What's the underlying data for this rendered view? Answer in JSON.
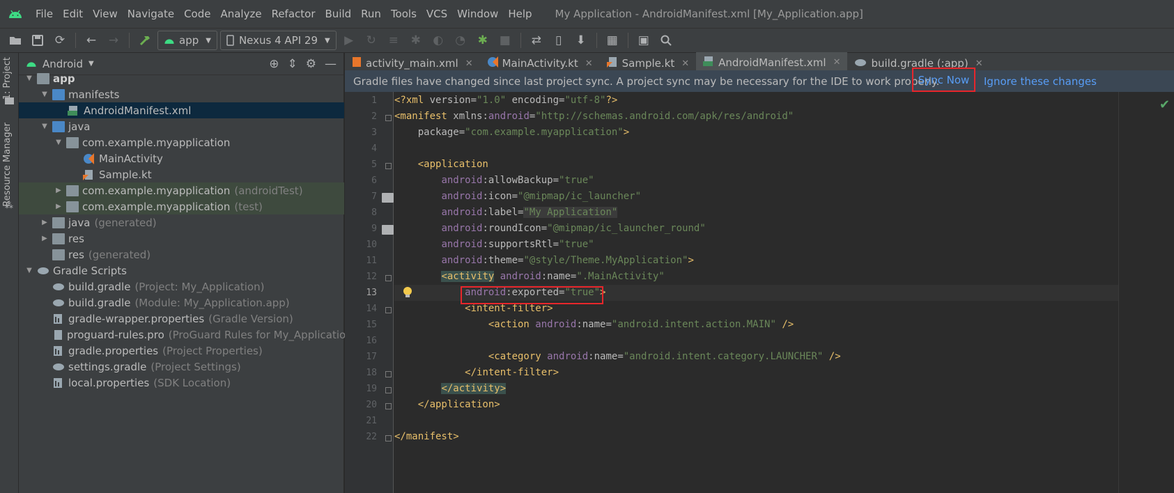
{
  "menubar": {
    "items": [
      "File",
      "Edit",
      "View",
      "Navigate",
      "Code",
      "Analyze",
      "Refactor",
      "Build",
      "Run",
      "Tools",
      "VCS",
      "Window",
      "Help"
    ],
    "title": "My Application - AndroidManifest.xml [My_Application.app]"
  },
  "toolbar": {
    "run_config": "app",
    "device": "Nexus 4 API 29"
  },
  "left_strip": {
    "project_label": "1: Project",
    "resource_manager_label": "Resource Manager"
  },
  "project_panel": {
    "view_mode": "Android",
    "tree": [
      {
        "label": "app",
        "hint": "",
        "bold": true
      },
      {
        "label": "manifests",
        "hint": ""
      },
      {
        "label": "AndroidManifest.xml",
        "hint": ""
      },
      {
        "label": "java",
        "hint": ""
      },
      {
        "label": "com.example.myapplication",
        "hint": ""
      },
      {
        "label": "MainActivity",
        "hint": ""
      },
      {
        "label": "Sample.kt",
        "hint": ""
      },
      {
        "label": "com.example.myapplication",
        "hint": "(androidTest)"
      },
      {
        "label": "com.example.myapplication",
        "hint": "(test)"
      },
      {
        "label": "java",
        "hint": "(generated)"
      },
      {
        "label": "res",
        "hint": ""
      },
      {
        "label": "res",
        "hint": "(generated)"
      },
      {
        "label": "Gradle Scripts",
        "hint": ""
      },
      {
        "label": "build.gradle",
        "hint": "(Project: My_Application)"
      },
      {
        "label": "build.gradle",
        "hint": "(Module: My_Application.app)"
      },
      {
        "label": "gradle-wrapper.properties",
        "hint": "(Gradle Version)"
      },
      {
        "label": "proguard-rules.pro",
        "hint": "(ProGuard Rules for My_Application.app)"
      },
      {
        "label": "gradle.properties",
        "hint": "(Project Properties)"
      },
      {
        "label": "settings.gradle",
        "hint": "(Project Settings)"
      },
      {
        "label": "local.properties",
        "hint": "(SDK Location)"
      }
    ]
  },
  "tabs": [
    {
      "label": "activity_main.xml",
      "active": false
    },
    {
      "label": "MainActivity.kt",
      "active": false
    },
    {
      "label": "Sample.kt",
      "active": false
    },
    {
      "label": "AndroidManifest.xml",
      "active": true
    },
    {
      "label": "build.gradle (:app)",
      "active": false
    }
  ],
  "banner": {
    "message": "Gradle files have changed since last project sync. A project sync may be necessary for the IDE to work properly.",
    "sync_now": "Sync Now",
    "ignore": "Ignore these changes"
  },
  "editor": {
    "current_line": 13,
    "line_numbers": [
      "1",
      "2",
      "3",
      "4",
      "5",
      "6",
      "7",
      "8",
      "9",
      "10",
      "11",
      "12",
      "13",
      "14",
      "15",
      "16",
      "17",
      "18",
      "19",
      "20",
      "21",
      "22"
    ]
  },
  "colors": {
    "tag": "#e8bf6a",
    "namespace": "#9876aa",
    "value": "#6a8759",
    "link": "#589df6",
    "highlight_box": "#e8262b"
  }
}
